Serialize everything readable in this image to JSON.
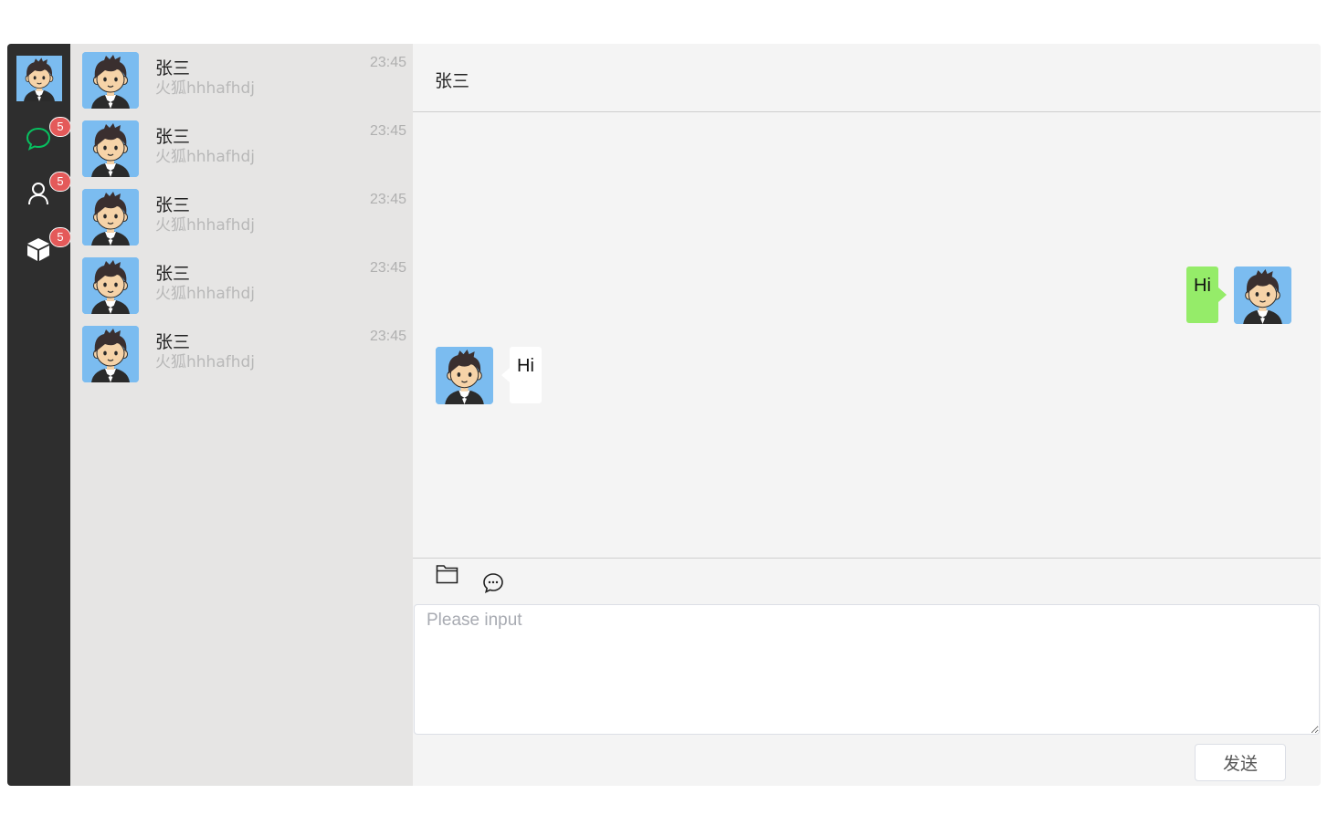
{
  "sidebar": {
    "user_avatar": "cartoon-boy-avatar",
    "nav": [
      {
        "name": "chat-icon",
        "badge": "5",
        "color": "#07c160"
      },
      {
        "name": "contacts-icon",
        "badge": "5",
        "color": "#ffffff"
      },
      {
        "name": "box-icon",
        "badge": "5",
        "color": "#ffffff"
      }
    ],
    "badge_color": "#e45a5a"
  },
  "conversations": [
    {
      "name": "张三",
      "preview": "火狐hhhafhdj",
      "time": "23:45"
    },
    {
      "name": "张三",
      "preview": "火狐hhhafhdj",
      "time": "23:45"
    },
    {
      "name": "张三",
      "preview": "火狐hhhafhdj",
      "time": "23:45"
    },
    {
      "name": "张三",
      "preview": "火狐hhhafhdj",
      "time": "23:45"
    },
    {
      "name": "张三",
      "preview": "火狐hhhafhdj",
      "time": "23:45"
    }
  ],
  "chat": {
    "title": "张三",
    "messages": [
      {
        "direction": "outgoing",
        "text": "Hi"
      },
      {
        "direction": "incoming",
        "text": "Hi"
      }
    ],
    "toolbar": {
      "folder": "folder-icon",
      "emoji": "chat-bubble-icon"
    },
    "input_placeholder": "Please input",
    "send_label": "发送"
  },
  "colors": {
    "rail_bg": "#2e2e2e",
    "list_bg": "#e6e5e4",
    "chat_bg": "#f4f4f4",
    "outgoing_bubble": "#95ec69",
    "incoming_bubble": "#ffffff",
    "avatar_bg": "#7bbcf0"
  }
}
